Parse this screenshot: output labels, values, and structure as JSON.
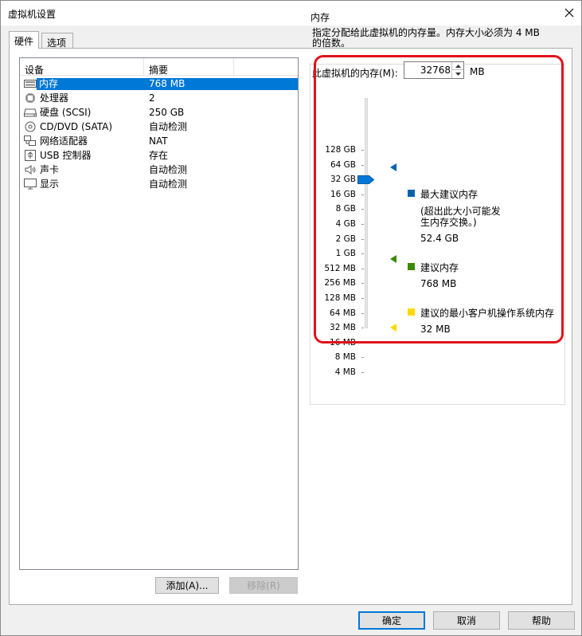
{
  "window": {
    "title": "虚拟机设置"
  },
  "tabs": [
    {
      "label": "硬件",
      "active": true
    },
    {
      "label": "选项",
      "active": false
    }
  ],
  "device_list": {
    "columns": [
      "设备",
      "摘要"
    ],
    "rows": [
      {
        "icon": "memory-icon",
        "name": "内存",
        "summary": "768 MB",
        "selected": true
      },
      {
        "icon": "processor-icon",
        "name": "处理器",
        "summary": "2",
        "selected": false
      },
      {
        "icon": "hard-disk-icon",
        "name": "硬盘 (SCSI)",
        "summary": "250 GB",
        "selected": false
      },
      {
        "icon": "cd-dvd-icon",
        "name": "CD/DVD (SATA)",
        "summary": "自动检测",
        "selected": false
      },
      {
        "icon": "network-adapter-icon",
        "name": "网络适配器",
        "summary": "NAT",
        "selected": false
      },
      {
        "icon": "usb-controller-icon",
        "name": "USB 控制器",
        "summary": "存在",
        "selected": false
      },
      {
        "icon": "sound-card-icon",
        "name": "声卡",
        "summary": "自动检测",
        "selected": false
      },
      {
        "icon": "display-icon",
        "name": "显示",
        "summary": "自动检测",
        "selected": false
      }
    ],
    "add_button": "添加(A)...",
    "remove_button": "移除(R)"
  },
  "memory": {
    "group_title": "内存",
    "description": "指定分配给此虚拟机的内存量。内存大小必须为 4 MB 的倍数。",
    "field_label": "此虚拟机的内存(M):",
    "value": "32768",
    "unit": "MB",
    "slider_ticks": [
      "128 GB",
      "64 GB",
      "32 GB",
      "16 GB",
      "8 GB",
      "4 GB",
      "2 GB",
      "1 GB",
      "512 MB",
      "256 MB",
      "128 MB",
      "64 MB",
      "32 MB",
      "16 MB",
      "8 MB",
      "4 MB"
    ],
    "slider_value": "32 GB",
    "legend": [
      {
        "title": "最大建议内存",
        "note": "(超出此大小可能发生内存交换。)",
        "value": "52.4 GB",
        "color": "#0063b1"
      },
      {
        "title": "建议内存",
        "value": "768 MB",
        "color": "#3a8a00"
      },
      {
        "title": "建议的最小客户机操作系统内存",
        "value": "32 MB",
        "color": "#ffd800"
      }
    ]
  },
  "footer": {
    "ok": "确定",
    "cancel": "取消",
    "help": "帮助"
  }
}
